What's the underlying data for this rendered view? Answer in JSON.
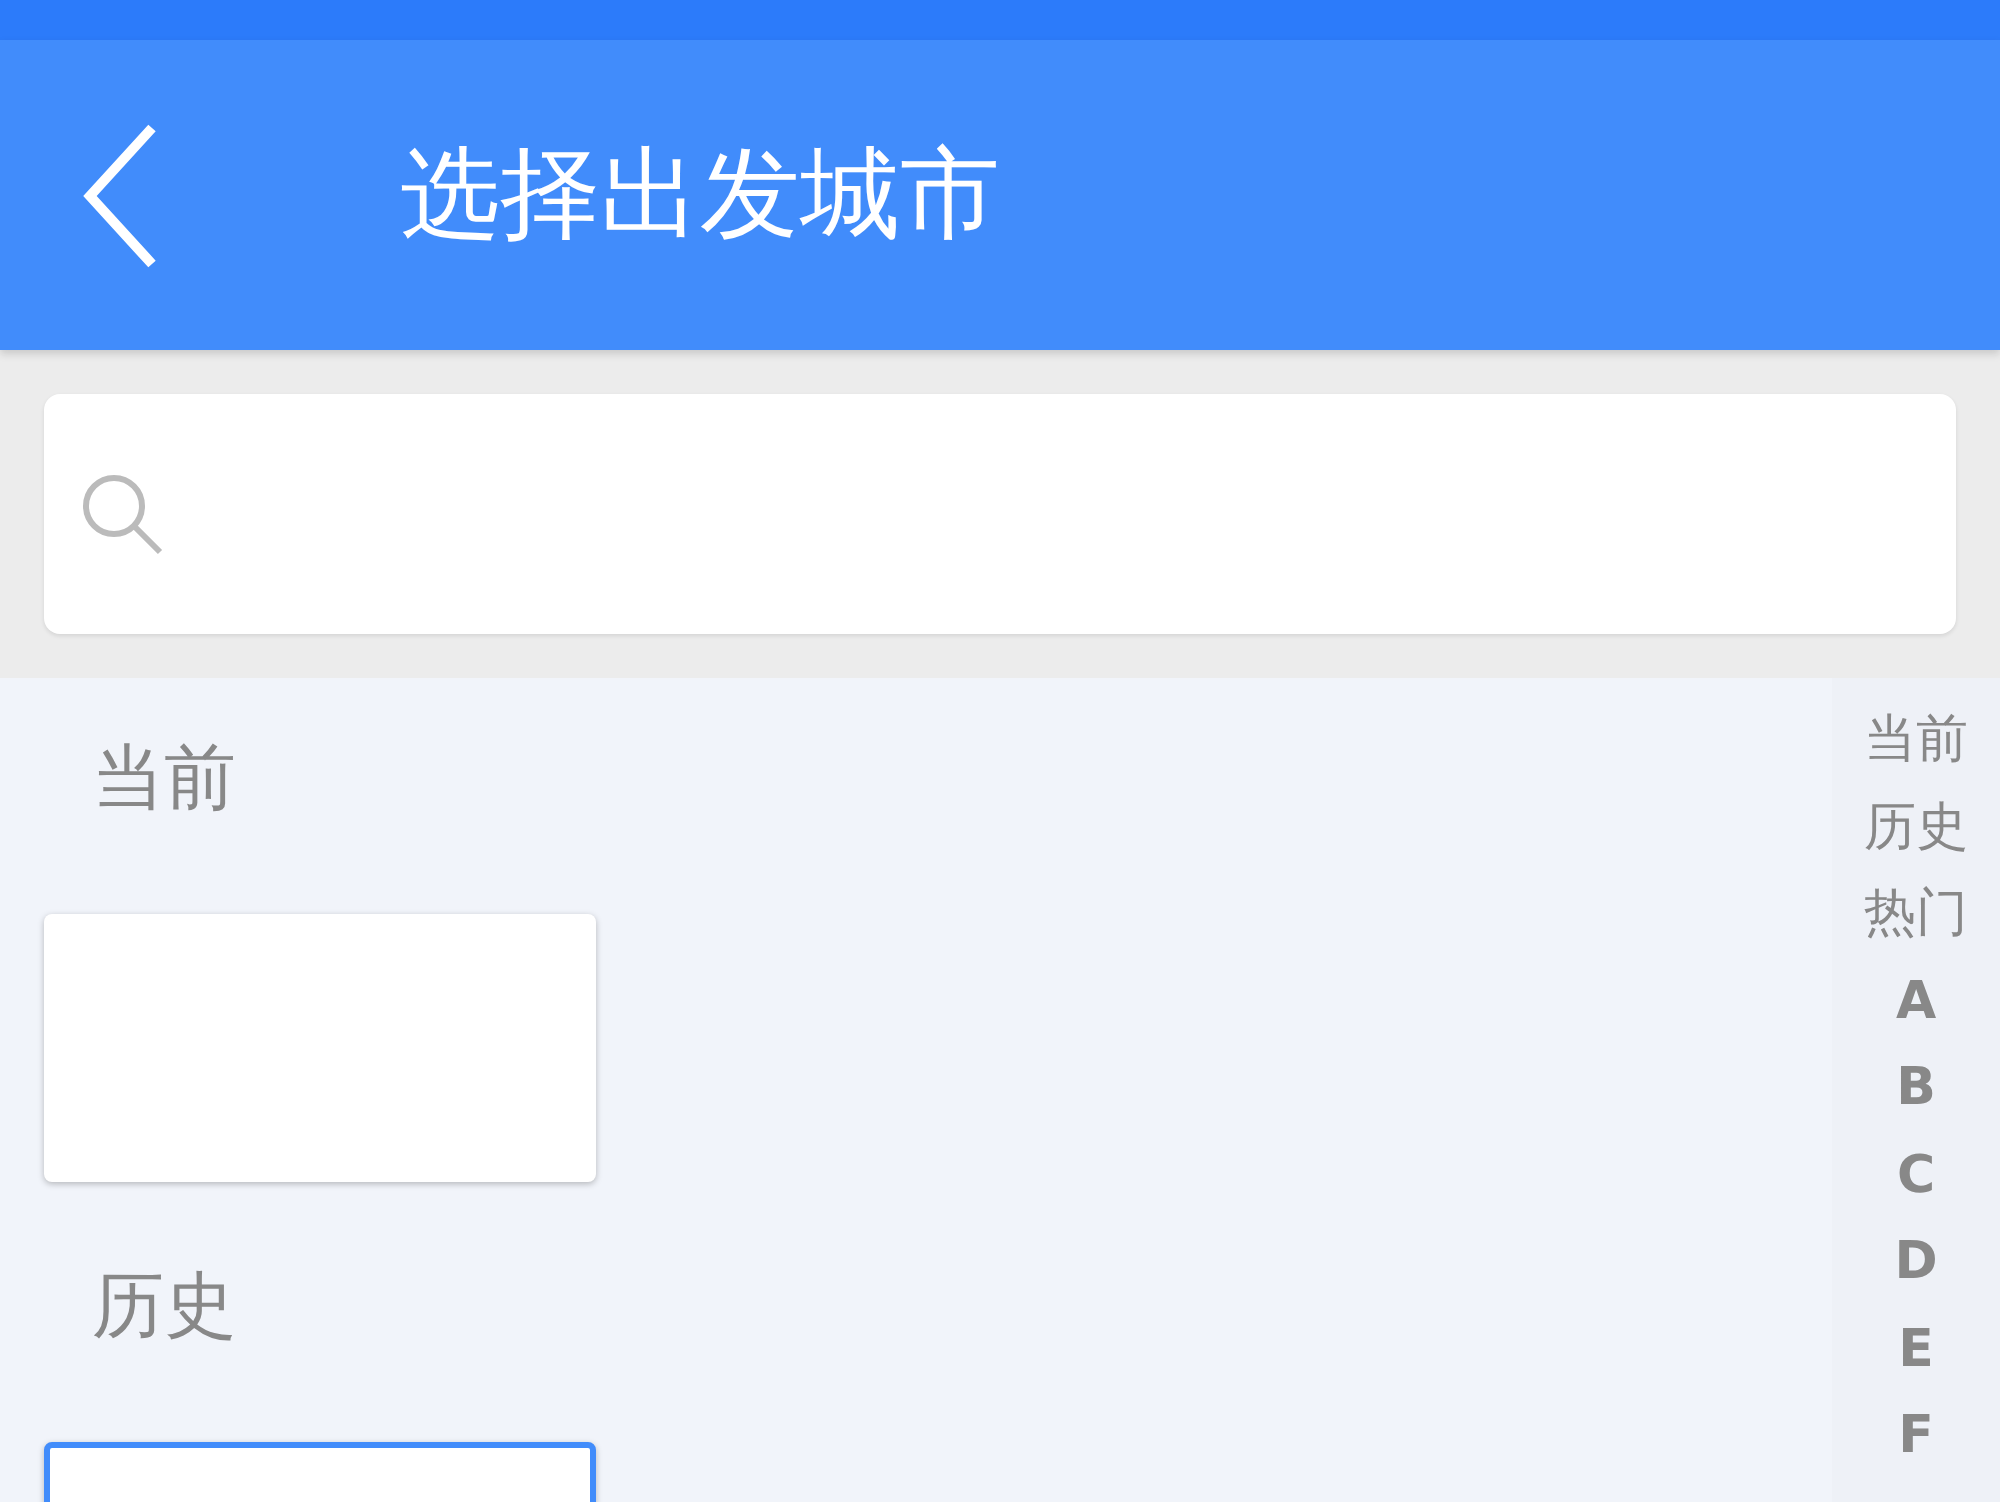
{
  "header": {
    "title": "选择出发城市"
  },
  "sections": [
    {
      "title": "当前",
      "card": {
        "highlighted": false
      }
    },
    {
      "title": "历史",
      "card": {
        "highlighted": true
      }
    }
  ],
  "index": [
    "当前",
    "历史",
    "热门",
    "A",
    "B",
    "C",
    "D",
    "E",
    "F"
  ]
}
